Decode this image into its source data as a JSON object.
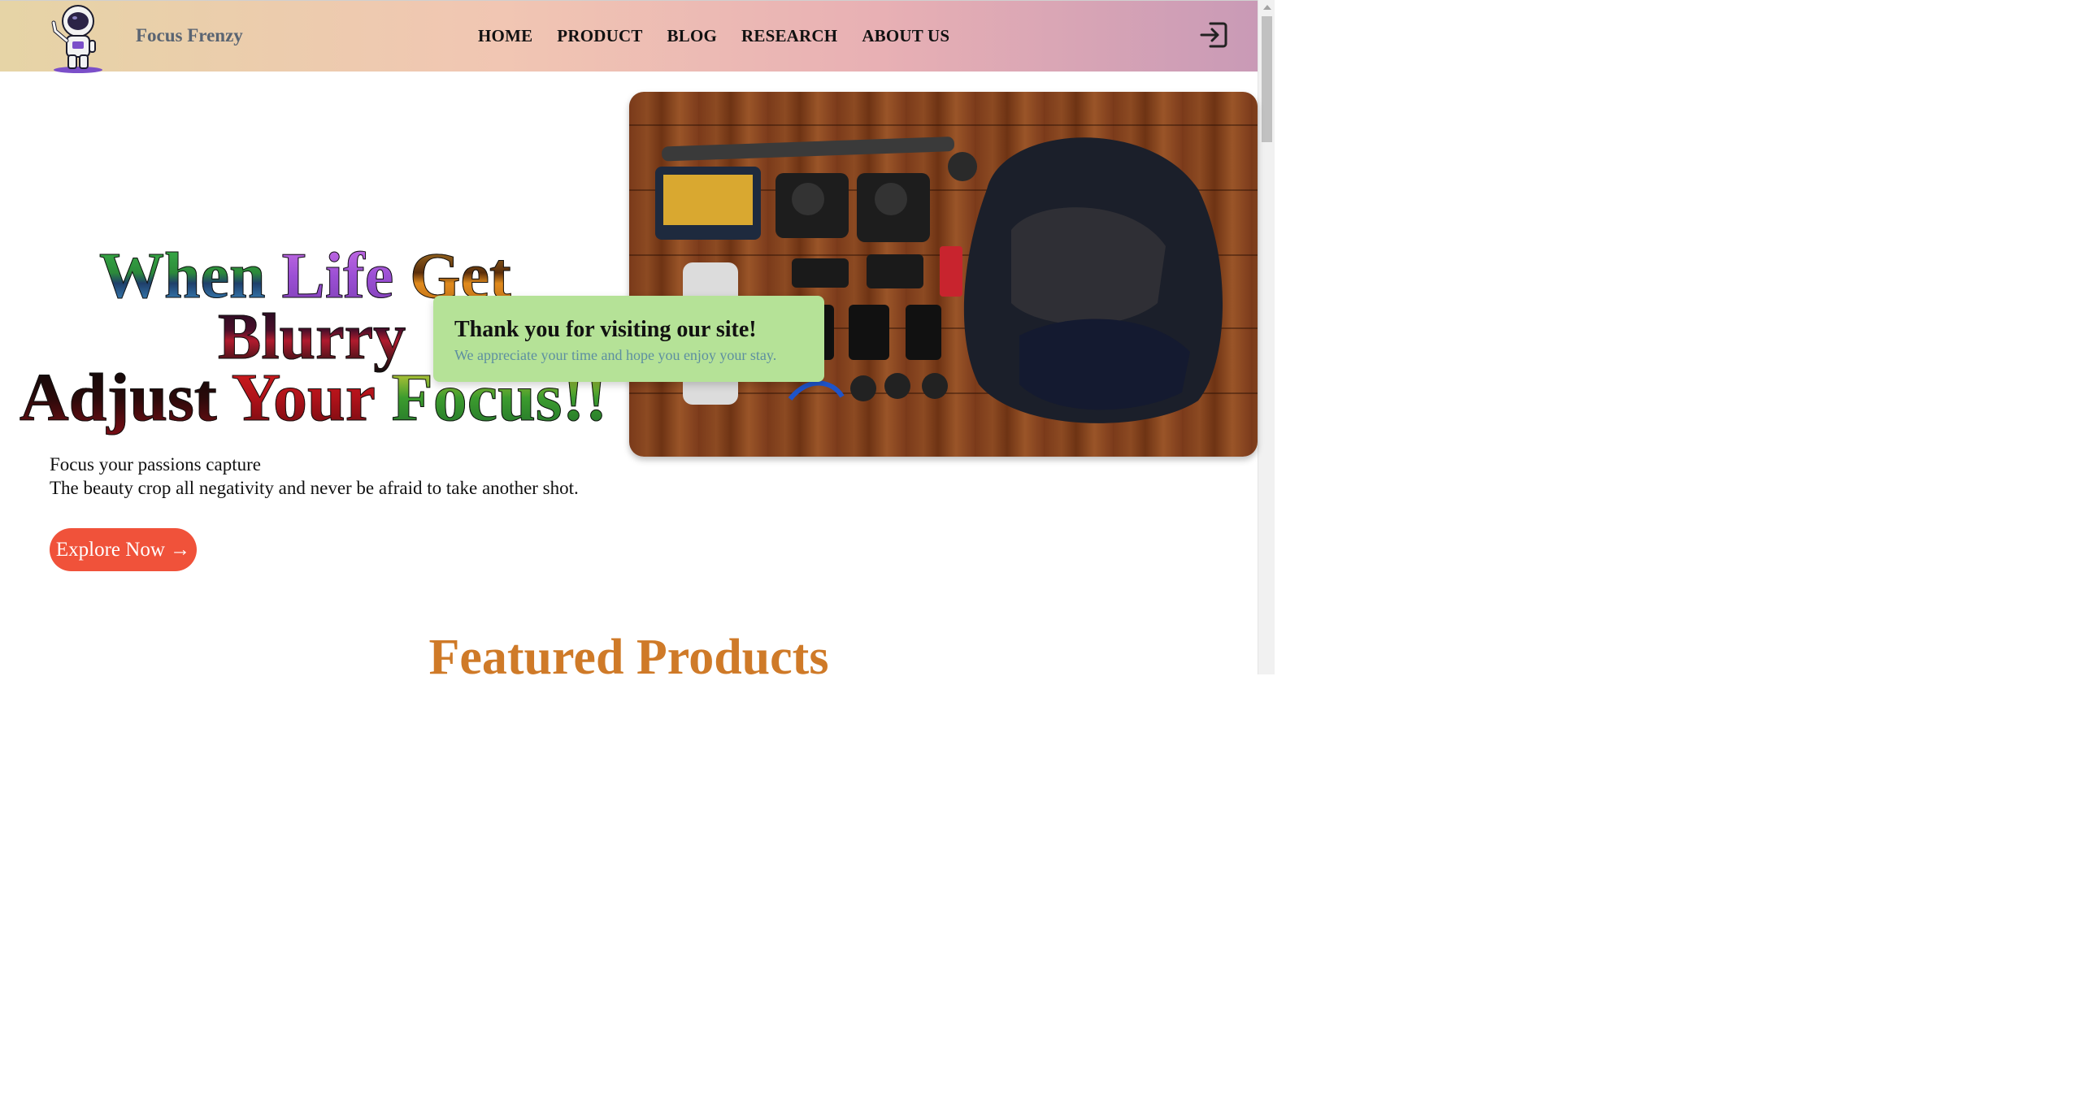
{
  "header": {
    "brand": "Focus Frenzy",
    "nav": [
      "HOME",
      "PRODUCT",
      "BLOG",
      "RESEARCH",
      "ABOUT US"
    ],
    "login_icon": "login-icon"
  },
  "hero": {
    "title_line1": [
      "When",
      "Life",
      "Get"
    ],
    "title_line2": [
      "Blurry"
    ],
    "title_line3": [
      "Adjust",
      "Your",
      "Focus!!"
    ],
    "subtitle_line1": "Focus your passions capture",
    "subtitle_line2": "The beauty crop all negativity and never be afraid to take another shot.",
    "cta": "Explore Now →"
  },
  "toast": {
    "title": "Thank you for visiting our site!",
    "message": "We appreciate your time and hope you enjoy your stay."
  },
  "featured": {
    "heading": "Featured Products"
  },
  "colors": {
    "cta_bg": "#f0523a",
    "toast_bg": "#b5e297",
    "featured_heading": "#cf7a28",
    "brand_text": "#5a6472"
  }
}
